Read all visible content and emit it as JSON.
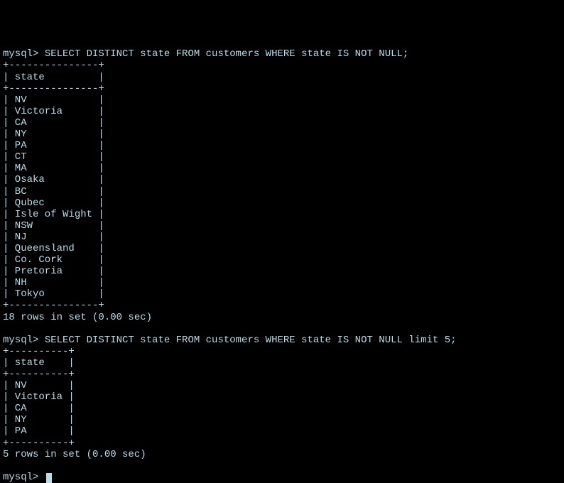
{
  "prompt_prefix": "mysql> ",
  "query1": {
    "sql": "SELECT DISTINCT state FROM customers WHERE state IS NOT NULL;",
    "border1_top": "+---------------+",
    "header_line": "| state         |",
    "border1_mid": "+---------------+",
    "rows": [
      "| NV            |",
      "| Victoria      |",
      "| CA            |",
      "| NY            |",
      "| PA            |",
      "| CT            |",
      "| MA            |",
      "| Osaka         |",
      "| BC            |",
      "| Qubec         |",
      "| Isle of Wight |",
      "| NSW           |",
      "| NJ            |",
      "| Queensland    |",
      "| Co. Cork      |",
      "| Pretoria      |",
      "| NH            |",
      "| Tokyo         |"
    ],
    "border1_bot": "+---------------+",
    "summary": "18 rows in set (0.00 sec)"
  },
  "query2": {
    "sql": "SELECT DISTINCT state FROM customers WHERE state IS NOT NULL limit 5;",
    "border2_top": "+----------+",
    "header_line": "| state    |",
    "border2_mid": "+----------+",
    "rows": [
      "| NV       |",
      "| Victoria |",
      "| CA       |",
      "| NY       |",
      "| PA       |"
    ],
    "border2_bot": "+----------+",
    "summary": "5 rows in set (0.00 sec)"
  }
}
